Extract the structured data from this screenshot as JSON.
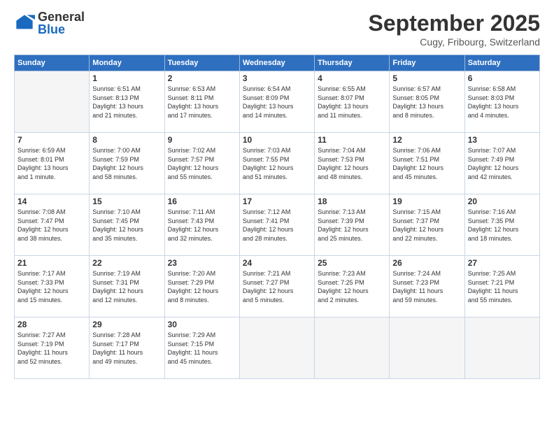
{
  "logo": {
    "general": "General",
    "blue": "Blue"
  },
  "header": {
    "month": "September 2025",
    "location": "Cugy, Fribourg, Switzerland"
  },
  "weekdays": [
    "Sunday",
    "Monday",
    "Tuesday",
    "Wednesday",
    "Thursday",
    "Friday",
    "Saturday"
  ],
  "weeks": [
    [
      {
        "day": "",
        "info": ""
      },
      {
        "day": "1",
        "info": "Sunrise: 6:51 AM\nSunset: 8:13 PM\nDaylight: 13 hours\nand 21 minutes."
      },
      {
        "day": "2",
        "info": "Sunrise: 6:53 AM\nSunset: 8:11 PM\nDaylight: 13 hours\nand 17 minutes."
      },
      {
        "day": "3",
        "info": "Sunrise: 6:54 AM\nSunset: 8:09 PM\nDaylight: 13 hours\nand 14 minutes."
      },
      {
        "day": "4",
        "info": "Sunrise: 6:55 AM\nSunset: 8:07 PM\nDaylight: 13 hours\nand 11 minutes."
      },
      {
        "day": "5",
        "info": "Sunrise: 6:57 AM\nSunset: 8:05 PM\nDaylight: 13 hours\nand 8 minutes."
      },
      {
        "day": "6",
        "info": "Sunrise: 6:58 AM\nSunset: 8:03 PM\nDaylight: 13 hours\nand 4 minutes."
      }
    ],
    [
      {
        "day": "7",
        "info": "Sunrise: 6:59 AM\nSunset: 8:01 PM\nDaylight: 13 hours\nand 1 minute."
      },
      {
        "day": "8",
        "info": "Sunrise: 7:00 AM\nSunset: 7:59 PM\nDaylight: 12 hours\nand 58 minutes."
      },
      {
        "day": "9",
        "info": "Sunrise: 7:02 AM\nSunset: 7:57 PM\nDaylight: 12 hours\nand 55 minutes."
      },
      {
        "day": "10",
        "info": "Sunrise: 7:03 AM\nSunset: 7:55 PM\nDaylight: 12 hours\nand 51 minutes."
      },
      {
        "day": "11",
        "info": "Sunrise: 7:04 AM\nSunset: 7:53 PM\nDaylight: 12 hours\nand 48 minutes."
      },
      {
        "day": "12",
        "info": "Sunrise: 7:06 AM\nSunset: 7:51 PM\nDaylight: 12 hours\nand 45 minutes."
      },
      {
        "day": "13",
        "info": "Sunrise: 7:07 AM\nSunset: 7:49 PM\nDaylight: 12 hours\nand 42 minutes."
      }
    ],
    [
      {
        "day": "14",
        "info": "Sunrise: 7:08 AM\nSunset: 7:47 PM\nDaylight: 12 hours\nand 38 minutes."
      },
      {
        "day": "15",
        "info": "Sunrise: 7:10 AM\nSunset: 7:45 PM\nDaylight: 12 hours\nand 35 minutes."
      },
      {
        "day": "16",
        "info": "Sunrise: 7:11 AM\nSunset: 7:43 PM\nDaylight: 12 hours\nand 32 minutes."
      },
      {
        "day": "17",
        "info": "Sunrise: 7:12 AM\nSunset: 7:41 PM\nDaylight: 12 hours\nand 28 minutes."
      },
      {
        "day": "18",
        "info": "Sunrise: 7:13 AM\nSunset: 7:39 PM\nDaylight: 12 hours\nand 25 minutes."
      },
      {
        "day": "19",
        "info": "Sunrise: 7:15 AM\nSunset: 7:37 PM\nDaylight: 12 hours\nand 22 minutes."
      },
      {
        "day": "20",
        "info": "Sunrise: 7:16 AM\nSunset: 7:35 PM\nDaylight: 12 hours\nand 18 minutes."
      }
    ],
    [
      {
        "day": "21",
        "info": "Sunrise: 7:17 AM\nSunset: 7:33 PM\nDaylight: 12 hours\nand 15 minutes."
      },
      {
        "day": "22",
        "info": "Sunrise: 7:19 AM\nSunset: 7:31 PM\nDaylight: 12 hours\nand 12 minutes."
      },
      {
        "day": "23",
        "info": "Sunrise: 7:20 AM\nSunset: 7:29 PM\nDaylight: 12 hours\nand 8 minutes."
      },
      {
        "day": "24",
        "info": "Sunrise: 7:21 AM\nSunset: 7:27 PM\nDaylight: 12 hours\nand 5 minutes."
      },
      {
        "day": "25",
        "info": "Sunrise: 7:23 AM\nSunset: 7:25 PM\nDaylight: 12 hours\nand 2 minutes."
      },
      {
        "day": "26",
        "info": "Sunrise: 7:24 AM\nSunset: 7:23 PM\nDaylight: 11 hours\nand 59 minutes."
      },
      {
        "day": "27",
        "info": "Sunrise: 7:25 AM\nSunset: 7:21 PM\nDaylight: 11 hours\nand 55 minutes."
      }
    ],
    [
      {
        "day": "28",
        "info": "Sunrise: 7:27 AM\nSunset: 7:19 PM\nDaylight: 11 hours\nand 52 minutes."
      },
      {
        "day": "29",
        "info": "Sunrise: 7:28 AM\nSunset: 7:17 PM\nDaylight: 11 hours\nand 49 minutes."
      },
      {
        "day": "30",
        "info": "Sunrise: 7:29 AM\nSunset: 7:15 PM\nDaylight: 11 hours\nand 45 minutes."
      },
      {
        "day": "",
        "info": ""
      },
      {
        "day": "",
        "info": ""
      },
      {
        "day": "",
        "info": ""
      },
      {
        "day": "",
        "info": ""
      }
    ]
  ]
}
